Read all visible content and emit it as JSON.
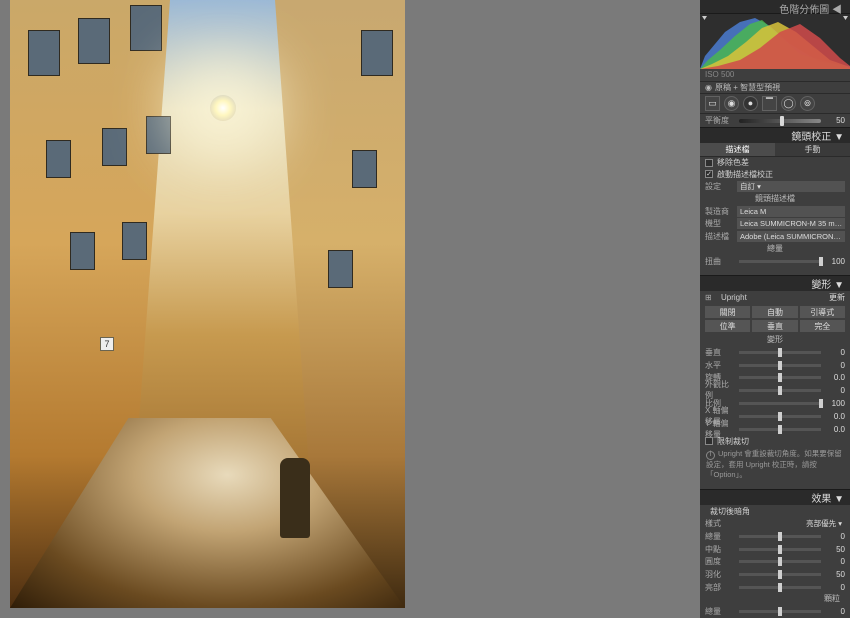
{
  "canvas_area": {
    "house_number": "7"
  },
  "panel": {
    "histogram_title": "色階分佈圖 ◀",
    "iso_line": {
      "iso": "ISO 500",
      "right": ""
    },
    "preview_line": "原稿 + 智慧型預視",
    "balance": {
      "label": "平衡度",
      "value": "50"
    },
    "lens_panel": {
      "title": "鏡頭校正 ▼",
      "tabs": {
        "profile": "描述檔",
        "manual": "手動",
        "active": "profile"
      },
      "remove_ca": {
        "label": "移除色差",
        "checked": false
      },
      "enable_profile": {
        "label": "啟動描述檔校正",
        "checked": true
      },
      "setup": {
        "label": "設定",
        "value": "自訂 ▾"
      },
      "subheader": "鏡頭描述檔",
      "make": {
        "label": "製造商",
        "value": "Leica M"
      },
      "model": {
        "label": "機型",
        "value": "Leica SUMMICRON-M 35 m…"
      },
      "profile": {
        "label": "描述檔",
        "value": "Adobe (Leica SUMMICRON…"
      },
      "amount_header": "總量",
      "sliders": {
        "distortion": {
          "label": "扭曲",
          "value": "100"
        }
      }
    },
    "transform_panel": {
      "title": "變形 ▼",
      "upright_row": {
        "icon_label": "⊞",
        "label": "Upright",
        "update": "更新"
      },
      "buttons": [
        "關閉",
        "自動",
        "引導式",
        "位準",
        "垂直",
        "完全"
      ],
      "subheader": "變形",
      "sliders": {
        "vertical": {
          "label": "垂直",
          "value": "0"
        },
        "horizontal": {
          "label": "水平",
          "value": "0"
        },
        "rotate": {
          "label": "旋轉",
          "value": "0.0"
        },
        "aspect": {
          "label": "外觀比例",
          "value": "0"
        },
        "scale": {
          "label": "比例",
          "value": "100"
        },
        "x_offset": {
          "label": "X 軸偏移量",
          "value": "0.0"
        },
        "y_offset": {
          "label": "Y 軸偏移量",
          "value": "0.0"
        }
      },
      "constrain_crop": {
        "label": "限制裁切",
        "checked": false
      },
      "note": "Upright 會重設裁切角度。如果要保留設定，套用 Upright 校正時，請按「Option」。"
    },
    "effects_panel": {
      "title": "效果 ▼",
      "vignette_header": "裁切後暗角",
      "style": {
        "label": "樣式",
        "value": "亮部優先 ▾"
      },
      "sliders": {
        "amount": {
          "label": "總量",
          "value": "0"
        },
        "midpoint": {
          "label": "中點",
          "value": "50"
        },
        "roundness": {
          "label": "圓度",
          "value": "0"
        },
        "feather": {
          "label": "羽化",
          "value": "50"
        },
        "highlights": {
          "label": "亮部",
          "value": "0"
        }
      },
      "grain_header": "顆粒",
      "grain": {
        "amount": {
          "label": "總量",
          "value": "0"
        }
      }
    }
  }
}
